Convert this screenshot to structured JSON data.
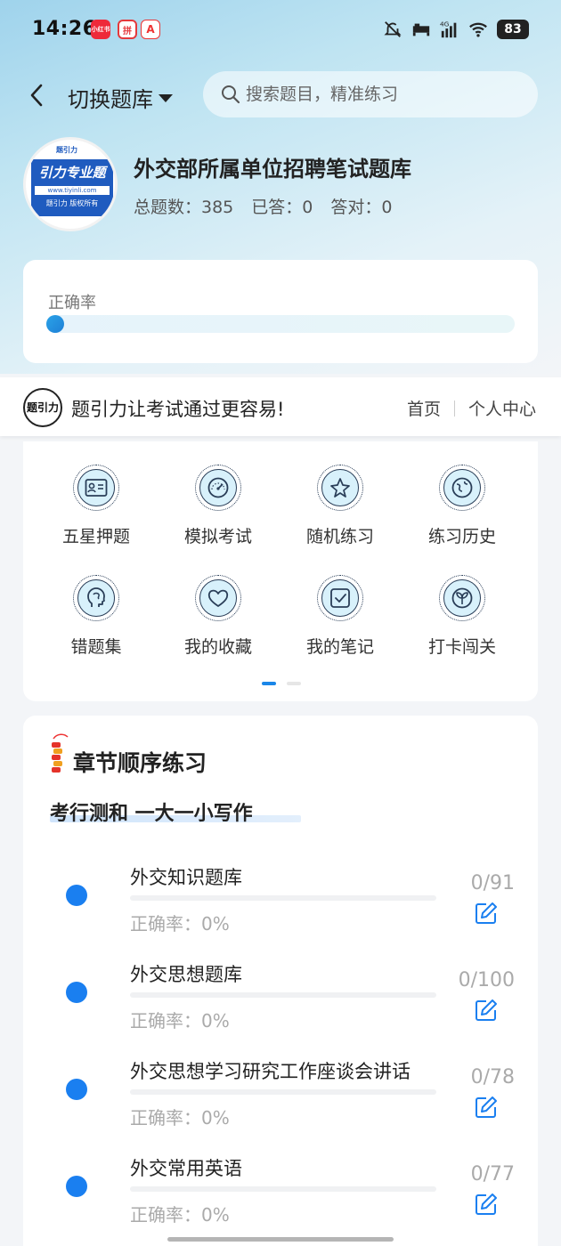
{
  "status_bar": {
    "time": "14:26",
    "app_badges": [
      "小红书",
      "拼",
      "A"
    ],
    "network": "4G",
    "battery": "83"
  },
  "header": {
    "back_icon": "chevron-left-icon",
    "switch_label": "切换题库",
    "search_placeholder": "搜索题目，精准练习"
  },
  "bank": {
    "logo_text": "引力专业题",
    "logo_top": "题引力",
    "logo_url": "www.tiyinli.com",
    "logo_foot": "题引力 版权所有",
    "title": "外交部所属单位招聘笔试题库",
    "total_label": "总题数：385",
    "answered_label": "已答：0",
    "correct_label": "答对：0"
  },
  "accuracy": {
    "label": "正确率",
    "value": 0
  },
  "promo": {
    "logo": "题引力",
    "slogan": "题引力让考试通过更容易!",
    "links": [
      "首页",
      "个人中心"
    ]
  },
  "functions": [
    {
      "label": "五星押题",
      "icon": "id-card-icon"
    },
    {
      "label": "模拟考试",
      "icon": "speedometer-icon"
    },
    {
      "label": "随机练习",
      "icon": "shuffle-star-icon"
    },
    {
      "label": "练习历史",
      "icon": "globe-history-icon"
    },
    {
      "label": "错题集",
      "icon": "head-brain-icon"
    },
    {
      "label": "我的收藏",
      "icon": "heart-icon"
    },
    {
      "label": "我的笔记",
      "icon": "note-check-icon"
    },
    {
      "label": "打卡闯关",
      "icon": "leaf-icon"
    }
  ],
  "chapter": {
    "title": "章节顺序练习",
    "subtitle": "考行测和 一大一小写作",
    "rows": [
      {
        "name": "外交知识题库",
        "accuracy": "正确率：0%",
        "count": "0/91"
      },
      {
        "name": "外交思想题库",
        "accuracy": "正确率：0%",
        "count": "0/100"
      },
      {
        "name": "外交思想学习研究工作座谈会讲话",
        "accuracy": "正确率：0%",
        "count": "0/78"
      },
      {
        "name": "外交常用英语",
        "accuracy": "正确率：0%",
        "count": "0/77"
      }
    ]
  },
  "colors": {
    "accent": "#1a7ff0",
    "icon_fill": "#d8f1fb"
  }
}
